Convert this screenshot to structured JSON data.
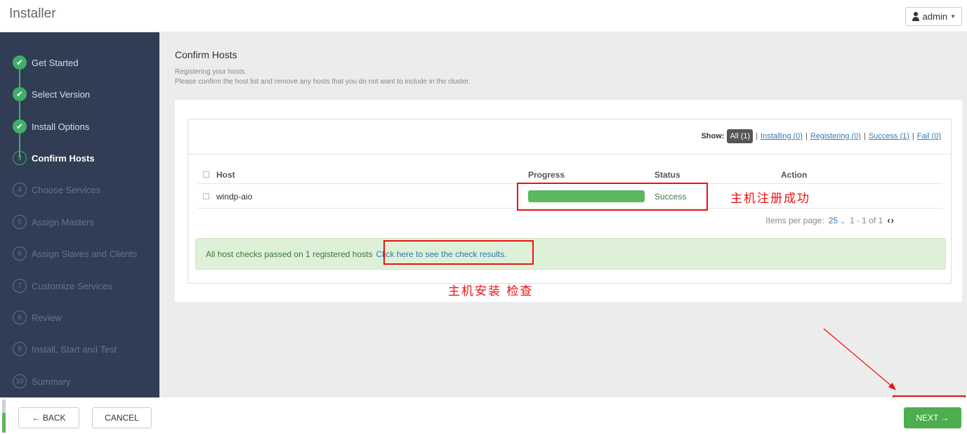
{
  "header": {
    "app_title": "Installer",
    "user_label": "admin",
    "user_icon": "user-icon"
  },
  "sidebar": {
    "steps": [
      {
        "number": "1",
        "label": "Get Started",
        "state": "done"
      },
      {
        "number": "2",
        "label": "Select Version",
        "state": "done"
      },
      {
        "number": "3",
        "label": "Install Options",
        "state": "done"
      },
      {
        "number": "3",
        "label": "Confirm Hosts",
        "state": "current"
      },
      {
        "number": "4",
        "label": "Choose Services",
        "state": "todo"
      },
      {
        "number": "5",
        "label": "Assign Masters",
        "state": "todo"
      },
      {
        "number": "6",
        "label": "Assign Slaves and Clients",
        "state": "todo"
      },
      {
        "number": "7",
        "label": "Customize Services",
        "state": "todo"
      },
      {
        "number": "8",
        "label": "Review",
        "state": "todo"
      },
      {
        "number": "9",
        "label": "Install, Start and Test",
        "state": "todo"
      },
      {
        "number": "10",
        "label": "Summary",
        "state": "todo"
      }
    ]
  },
  "main": {
    "title": "Confirm Hosts",
    "subtitle_line1": "Registering your hosts.",
    "subtitle_line2": "Please confirm the host list and remove any hosts that you do not want to include in the cluster.",
    "filter": {
      "show_label": "Show:",
      "all": "All (1)",
      "installing": "Installing (0)",
      "registering": "Registering (0)",
      "success": "Success (1)",
      "fail": "Fail (0)"
    },
    "table": {
      "columns": [
        "Host",
        "Progress",
        "Status",
        "Action"
      ],
      "rows": [
        {
          "host": "windp-aio",
          "progress_percent": 100,
          "status": "Success",
          "action": ""
        }
      ]
    },
    "pagination": {
      "items_per_page_label": "Items per page:",
      "items_per_page": "25",
      "range": "1 - 1 of 1"
    },
    "alert": {
      "text": "All host checks passed on 1 registered hosts",
      "link": "Click here to see the check results."
    }
  },
  "annotations": {
    "registration_note": "主机注册成功",
    "check_note": "主机安装 检查"
  },
  "footer": {
    "back_label": "← BACK",
    "cancel_label": "CANCEL",
    "next_label": "NEXT →"
  },
  "colors": {
    "sidebar_bg": "#313d54",
    "success_green": "#3fae6a",
    "progress_green": "#5cb85c",
    "annotation_red": "#ee1111",
    "link_blue": "#337ab7"
  }
}
